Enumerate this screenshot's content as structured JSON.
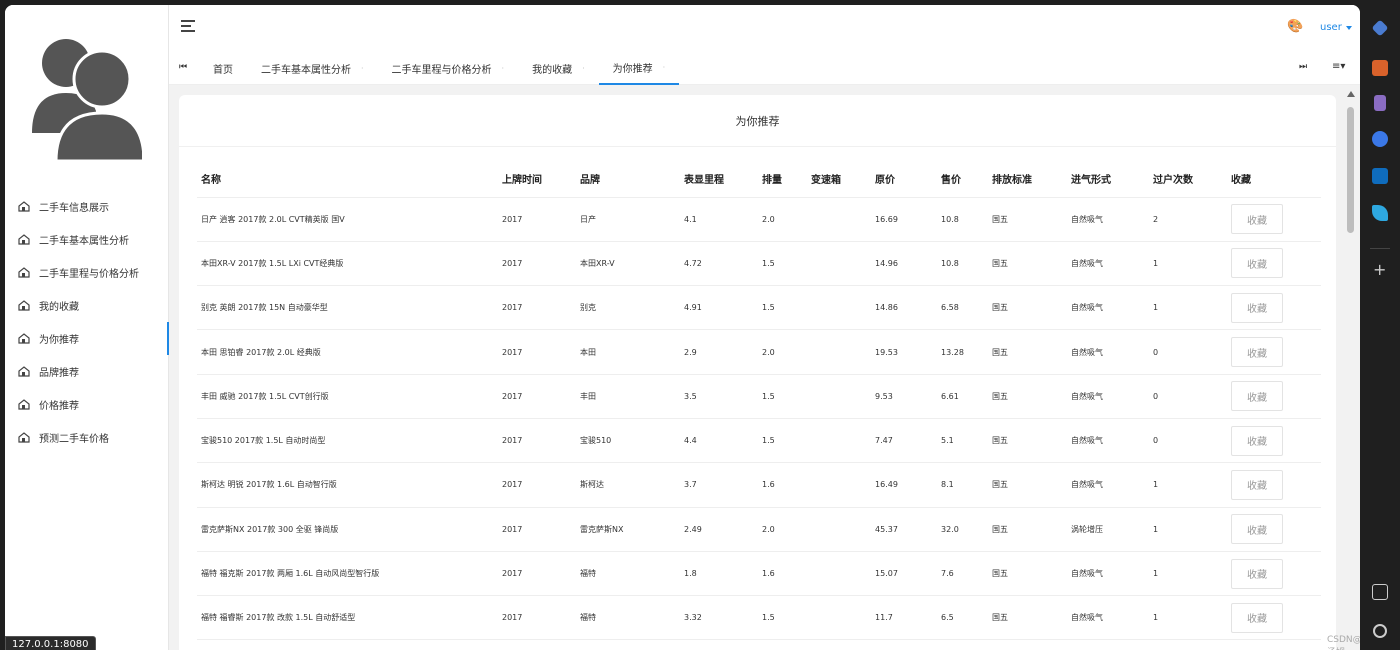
{
  "sidebar": {
    "items": [
      {
        "label": "二手车信息展示",
        "active": false
      },
      {
        "label": "二手车基本属性分析",
        "active": false
      },
      {
        "label": "二手车里程与价格分析",
        "active": false
      },
      {
        "label": "我的收藏",
        "active": false
      },
      {
        "label": "为你推荐",
        "active": true
      },
      {
        "label": "品牌推荐",
        "active": false
      },
      {
        "label": "价格推荐",
        "active": false
      },
      {
        "label": "预测二手车价格",
        "active": false
      }
    ]
  },
  "header": {
    "user": "user"
  },
  "tabs": [
    {
      "label": "首页",
      "closable": false,
      "active": false
    },
    {
      "label": "二手车基本属性分析",
      "closable": true,
      "active": false
    },
    {
      "label": "二手车里程与价格分析",
      "closable": true,
      "active": false
    },
    {
      "label": "我的收藏",
      "closable": true,
      "active": false
    },
    {
      "label": "为你推荐",
      "closable": true,
      "active": true
    }
  ],
  "card": {
    "title": "为你推荐"
  },
  "table": {
    "columns": [
      "名称",
      "上牌时间",
      "品牌",
      "表显里程",
      "排量",
      "变速箱",
      "原价",
      "售价",
      "排放标准",
      "进气形式",
      "过户次数",
      "收藏"
    ],
    "fav_label": "收藏",
    "rows": [
      [
        "日产 逍客 2017款 2.0L CVT精英版 国V",
        "2017",
        "日产",
        "4.1",
        "2.0",
        "",
        "16.69",
        "10.8",
        "国五",
        "自然吸气",
        "2"
      ],
      [
        "本田XR-V 2017款 1.5L LXi CVT经典版",
        "2017",
        "本田XR-V",
        "4.72",
        "1.5",
        "",
        "14.96",
        "10.8",
        "国五",
        "自然吸气",
        "1"
      ],
      [
        "别克 英朗 2017款 15N 自动豪华型",
        "2017",
        "别克",
        "4.91",
        "1.5",
        "",
        "14.86",
        "6.58",
        "国五",
        "自然吸气",
        "1"
      ],
      [
        "本田 思铂睿 2017款 2.0L 经典版",
        "2017",
        "本田",
        "2.9",
        "2.0",
        "",
        "19.53",
        "13.28",
        "国五",
        "自然吸气",
        "0"
      ],
      [
        "丰田 威驰 2017款 1.5L CVT创行版",
        "2017",
        "丰田",
        "3.5",
        "1.5",
        "",
        "9.53",
        "6.61",
        "国五",
        "自然吸气",
        "0"
      ],
      [
        "宝骏510 2017款 1.5L 自动时尚型",
        "2017",
        "宝骏510",
        "4.4",
        "1.5",
        "",
        "7.47",
        "5.1",
        "国五",
        "自然吸气",
        "0"
      ],
      [
        "斯柯达 明锐 2017款 1.6L 自动智行版",
        "2017",
        "斯柯达",
        "3.7",
        "1.6",
        "",
        "16.49",
        "8.1",
        "国五",
        "自然吸气",
        "1"
      ],
      [
        "雷克萨斯NX 2017款 300 全驱 锋尚版",
        "2017",
        "雷克萨斯NX",
        "2.49",
        "2.0",
        "",
        "45.37",
        "32.0",
        "国五",
        "涡轮增压",
        "1"
      ],
      [
        "福特 福克斯 2017款 两厢 1.6L 自动风尚型智行版",
        "2017",
        "福特",
        "1.8",
        "1.6",
        "",
        "15.07",
        "7.6",
        "国五",
        "自然吸气",
        "1"
      ],
      [
        "福特 福睿斯 2017款 改款 1.5L 自动舒适型",
        "2017",
        "福特",
        "3.32",
        "1.5",
        "",
        "11.7",
        "6.5",
        "国五",
        "自然吸气",
        "1"
      ]
    ]
  },
  "status": {
    "url": "127.0.0.1:8080"
  },
  "watermark": "CSDN@汤姆"
}
